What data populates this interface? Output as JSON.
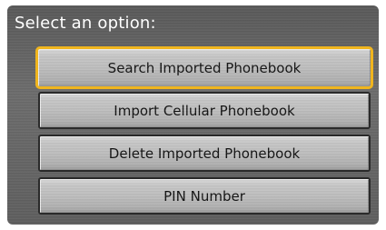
{
  "screen": {
    "prompt": "Select an option:"
  },
  "menu": {
    "items": [
      {
        "label": "Search Imported Phonebook",
        "selected": true
      },
      {
        "label": "Import Cellular Phonebook",
        "selected": false
      },
      {
        "label": "Delete Imported Phonebook",
        "selected": false
      },
      {
        "label": "PIN Number",
        "selected": false
      }
    ]
  },
  "colors": {
    "background": "#666666",
    "button_face": "#bdbdbd",
    "selection_highlight": "#f0b51e",
    "prompt_text": "#ffffff",
    "button_text": "#111111"
  }
}
